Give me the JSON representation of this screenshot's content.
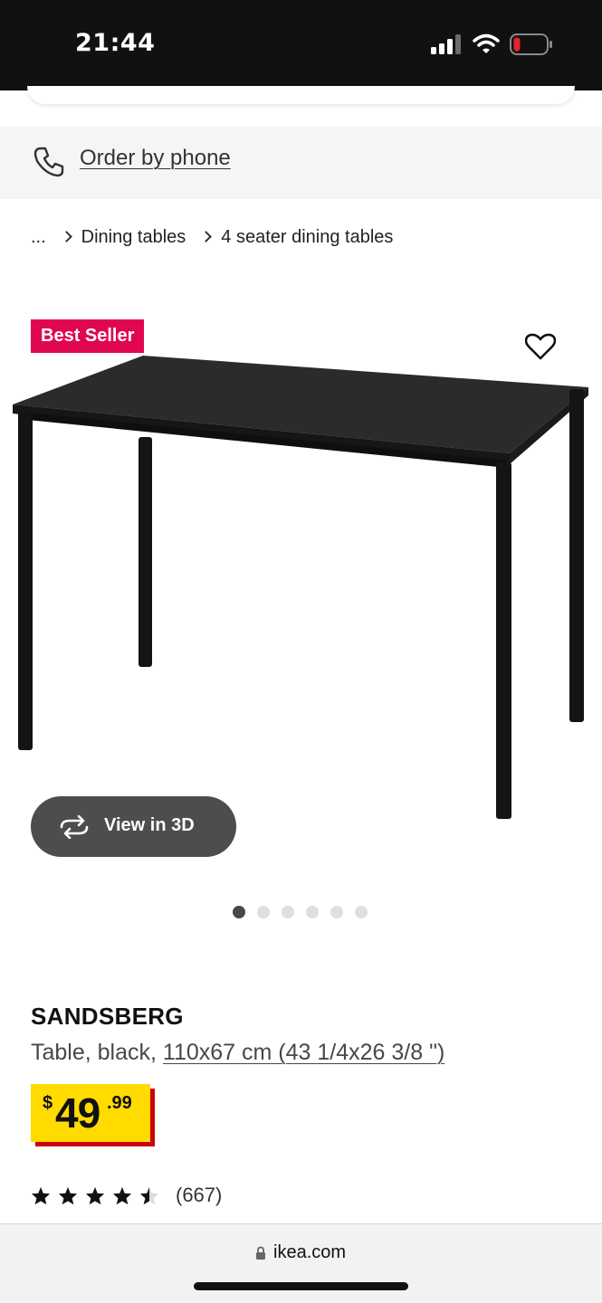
{
  "status_bar": {
    "time": "21:44",
    "icons": [
      "signal-icon",
      "wifi-icon",
      "battery-low-icon"
    ],
    "battery_color": "#e0262b"
  },
  "order_bar": {
    "icon": "phone-icon",
    "label": "Order by phone"
  },
  "breadcrumb": {
    "items": [
      "...",
      "Dining tables",
      "4 seater dining tables"
    ]
  },
  "product_media": {
    "badge": "Best Seller",
    "badge_color": "#e00751",
    "favorite_icon": "heart-icon",
    "view3d_label": "View in 3D",
    "view3d_icon": "rotate-3d-icon",
    "carousel_total": 6,
    "carousel_active_index": 0
  },
  "product": {
    "name": "SANDSBERG",
    "description_prefix": "Table, black, ",
    "size_link": "110x67 cm (43 1/4x26 3/8 \")",
    "price": {
      "currency": "$",
      "integer": "49",
      "decimal": ".99",
      "background": "#ffdb00",
      "shadow": "#cc0008"
    },
    "rating": {
      "stars": 4.5,
      "max": 5,
      "count_label": "(667)"
    }
  },
  "browser": {
    "url": "ikea.com",
    "icon": "lock-icon"
  }
}
